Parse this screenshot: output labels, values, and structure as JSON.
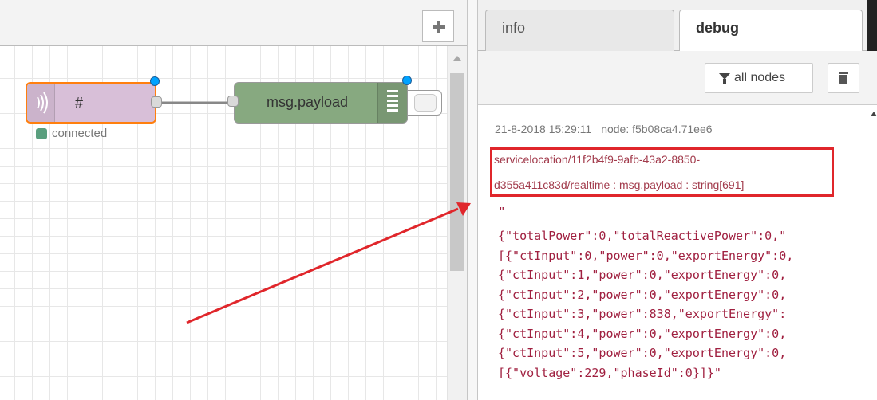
{
  "workspace": {
    "add_button_icon": "plus-icon",
    "nodes": {
      "mqtt_in": {
        "label": "#",
        "icon": "mqtt-icon",
        "fill": "#d8bfd8",
        "selected_border": "#ff7f0e",
        "status": {
          "color": "#5a9f7e",
          "text": "connected"
        }
      },
      "debug": {
        "label": "msg.payload",
        "icon": "debug-list-icon",
        "fill": "#87a980"
      }
    },
    "changed_badge_color": "#00a3ff"
  },
  "sidebar": {
    "tabs": [
      {
        "label": "info",
        "active": false
      },
      {
        "label": "debug",
        "active": true
      }
    ],
    "toolbar": {
      "filter_label": "all nodes",
      "filter_icon": "filter-icon",
      "clear_icon": "trash-icon"
    },
    "message": {
      "timestamp": "21-8-2018 15:29:11",
      "node": "node: f5b08ca4.71ee6",
      "topic_line_1": "servicelocation/11f2b4f9-9afb-43a2-8850-",
      "topic_line_2": "d355a411c83d/realtime : msg.payload : string[691]",
      "highlight_color": "#e0262b",
      "payload_quote": "\"",
      "payload_lines": [
        "{\"totalPower\":0,\"totalReactivePower\":0,\"",
        "[{\"ctInput\":0,\"power\":0,\"exportEnergy\":0,",
        "{\"ctInput\":1,\"power\":0,\"exportEnergy\":0,",
        "{\"ctInput\":2,\"power\":0,\"exportEnergy\":0,",
        "{\"ctInput\":3,\"power\":838,\"exportEnergy\":",
        "{\"ctInput\":4,\"power\":0,\"exportEnergy\":0,",
        "{\"ctInput\":5,\"power\":0,\"exportEnergy\":0,",
        "[{\"voltage\":229,\"phaseId\":0}]}\""
      ]
    }
  },
  "annotation": {
    "arrow_color": "#e0262b"
  }
}
